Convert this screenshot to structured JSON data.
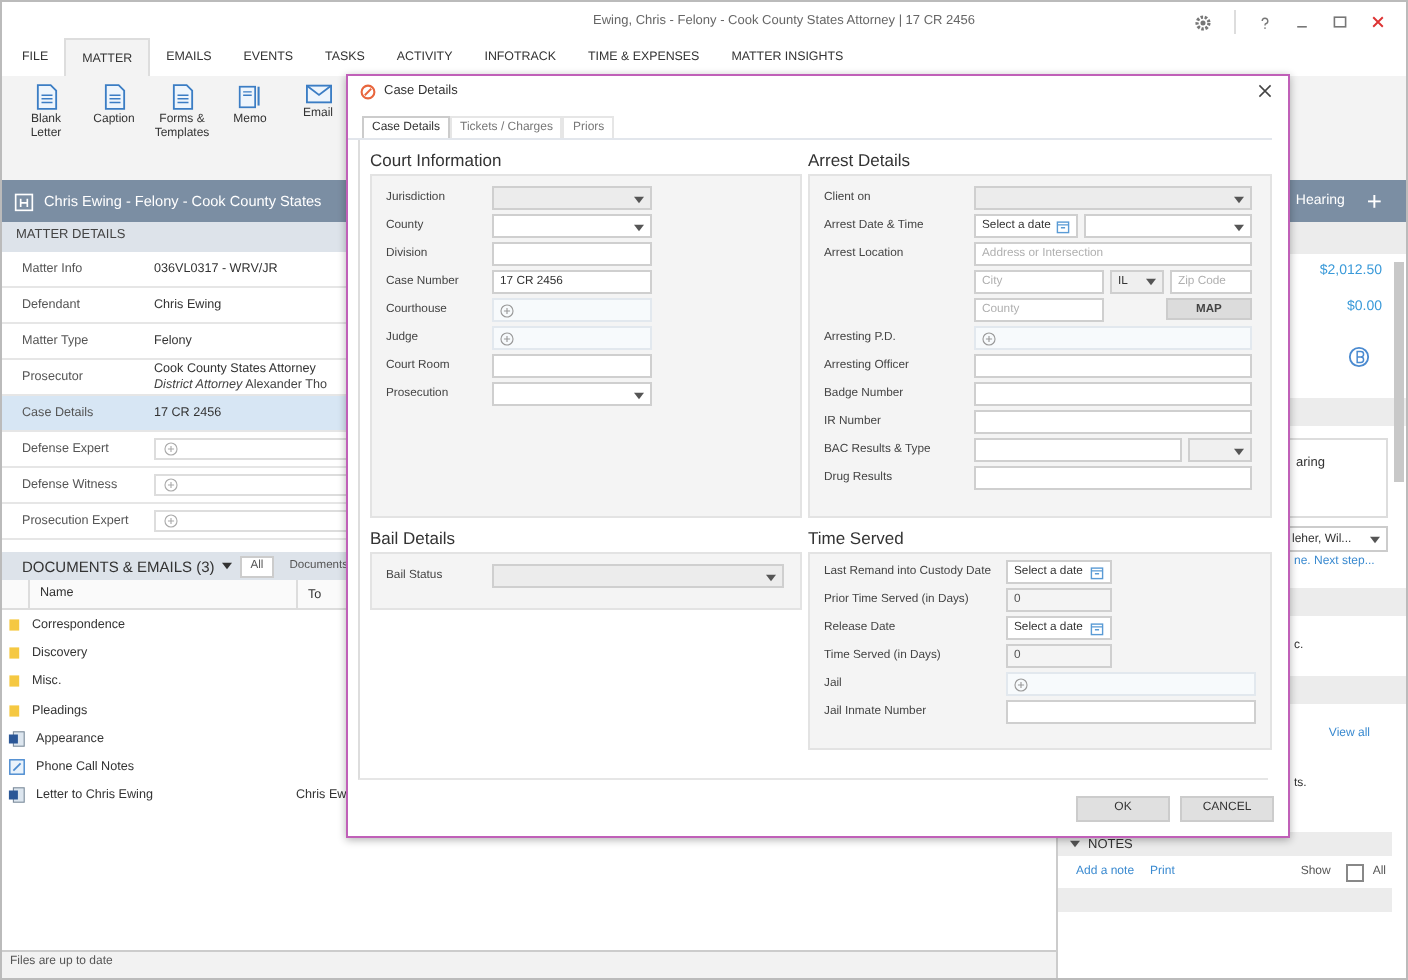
{
  "window": {
    "title": "Ewing, Chris - Felony - Cook County States Attorney | 17 CR 2456"
  },
  "menu_tabs": [
    {
      "label": "FILE",
      "selected": false
    },
    {
      "label": "MATTER",
      "selected": true
    },
    {
      "label": "EMAILS",
      "selected": false
    },
    {
      "label": "EVENTS",
      "selected": false
    },
    {
      "label": "TASKS",
      "selected": false
    },
    {
      "label": "ACTIVITY",
      "selected": false
    },
    {
      "label": "INFOTRACK",
      "selected": false
    },
    {
      "label": "TIME & EXPENSES",
      "selected": false
    },
    {
      "label": "MATTER INSIGHTS",
      "selected": false
    }
  ],
  "ribbon": [
    {
      "label": "Blank Letter",
      "kind": "doc"
    },
    {
      "label": "Caption",
      "kind": "doc"
    },
    {
      "label": "Forms & Templates",
      "kind": "doc"
    },
    {
      "label": "Memo",
      "kind": "memo"
    },
    {
      "label": "Email",
      "kind": "mail"
    }
  ],
  "matter_header": {
    "title": "Chris Ewing - Felony - Cook County States",
    "event": "Hearing",
    "add": "+"
  },
  "matter_details": {
    "title": "MATTER DETAILS",
    "rows": [
      {
        "label": "Matter Info",
        "value": "036VL0317 - WRV/JR",
        "kind": "text",
        "selected": false
      },
      {
        "label": "Defendant",
        "value": "Chris Ewing",
        "kind": "text",
        "selected": false
      },
      {
        "label": "Matter Type",
        "value": "Felony",
        "kind": "text",
        "selected": false
      },
      {
        "label": "Prosecutor",
        "value": "Cook County States Attorney",
        "note": "*District Attorney* Alexander Tho",
        "kind": "text",
        "selected": false
      },
      {
        "label": "Case Details",
        "value": "17 CR 2456",
        "kind": "text",
        "selected": true
      },
      {
        "label": "Defense Expert",
        "kind": "lookup",
        "selected": false
      },
      {
        "label": "Defense Witness",
        "kind": "lookup",
        "selected": false
      },
      {
        "label": "Prosecution Expert",
        "kind": "lookup",
        "selected": false
      }
    ]
  },
  "documents": {
    "title": "DOCUMENTS & EMAILS (3)",
    "filters": [
      {
        "label": "All",
        "selected": true
      },
      {
        "label": "Documents",
        "selected": false
      }
    ],
    "columns": [
      "Name",
      "To"
    ],
    "rows": [
      {
        "name": "Correspondence",
        "kind": "folder"
      },
      {
        "name": "Discovery",
        "kind": "folder"
      },
      {
        "name": "Misc.",
        "kind": "folder"
      },
      {
        "name": "Pleadings",
        "kind": "folder"
      },
      {
        "name": "Appearance",
        "kind": "doc"
      },
      {
        "name": "Phone Call Notes",
        "kind": "note"
      },
      {
        "name": "Letter to Chris Ewing",
        "to": "Chris Ew",
        "kind": "doc"
      }
    ]
  },
  "status_bar": "Files are up to date",
  "right_panel": {
    "amounts": [
      "$2,012.50",
      "$0.00"
    ],
    "box_text": "aring",
    "assignee": "leher, Wil...",
    "next_step": "ne. Next step...",
    "fragment_1": "c.",
    "view_all": "View all",
    "fragment_2": "ts.",
    "notes": {
      "title": "NOTES",
      "add": "Add a note",
      "print": "Print",
      "show": "Show",
      "all": "All",
      "all_checked": false
    }
  },
  "dialog": {
    "title": "Case Details",
    "tabs": [
      {
        "label": "Case Details",
        "selected": true
      },
      {
        "label": "Tickets / Charges",
        "selected": false
      },
      {
        "label": "Priors",
        "selected": false
      }
    ],
    "court": {
      "title": "Court Information",
      "fields": [
        {
          "label": "Jurisdiction",
          "kind": "locked"
        },
        {
          "label": "County",
          "kind": "select"
        },
        {
          "label": "Division",
          "kind": "text"
        },
        {
          "label": "Case Number",
          "kind": "text",
          "value": "17 CR 2456"
        },
        {
          "label": "Courthouse",
          "kind": "lookup"
        },
        {
          "label": "Judge",
          "kind": "lookup"
        },
        {
          "label": "Court Room",
          "kind": "text"
        },
        {
          "label": "Prosecution",
          "kind": "select"
        }
      ]
    },
    "arrest": {
      "title": "Arrest Details",
      "fields": [
        {
          "label": "Client on",
          "kind": "locked"
        },
        {
          "label": "Arrest Date & Time",
          "kind": "datetime",
          "placeholder": "Select a date"
        },
        {
          "label": "Arrest Location",
          "kind": "address",
          "street": "Address or Intersection",
          "city": "City",
          "state": "IL",
          "zip": "Zip Code",
          "county": "County",
          "button": "MAP"
        },
        {
          "label": "Arresting P.D.",
          "kind": "lookup"
        },
        {
          "label": "Arresting Officer",
          "kind": "text"
        },
        {
          "label": "Badge Number",
          "kind": "text"
        },
        {
          "label": "IR Number",
          "kind": "text"
        },
        {
          "label": "BAC Results & Type",
          "kind": "textselect"
        },
        {
          "label": "Drug Results",
          "kind": "text"
        }
      ]
    },
    "bail": {
      "title": "Bail Details",
      "fields": [
        {
          "label": "Bail Status",
          "kind": "locked"
        }
      ]
    },
    "time_served": {
      "title": "Time Served",
      "fields": [
        {
          "label": "Last Remand into Custody Date",
          "kind": "date",
          "placeholder": "Select a date"
        },
        {
          "label": "Prior Time Served (in Days)",
          "kind": "readonly",
          "value": "0"
        },
        {
          "label": "Release Date",
          "kind": "date",
          "placeholder": "Select a date"
        },
        {
          "label": "Time Served (in Days)",
          "kind": "readonly",
          "value": "0"
        },
        {
          "label": "Jail",
          "kind": "lookup"
        },
        {
          "label": "Jail Inmate Number",
          "kind": "text"
        }
      ]
    },
    "buttons": [
      "OK",
      "CANCEL"
    ]
  }
}
